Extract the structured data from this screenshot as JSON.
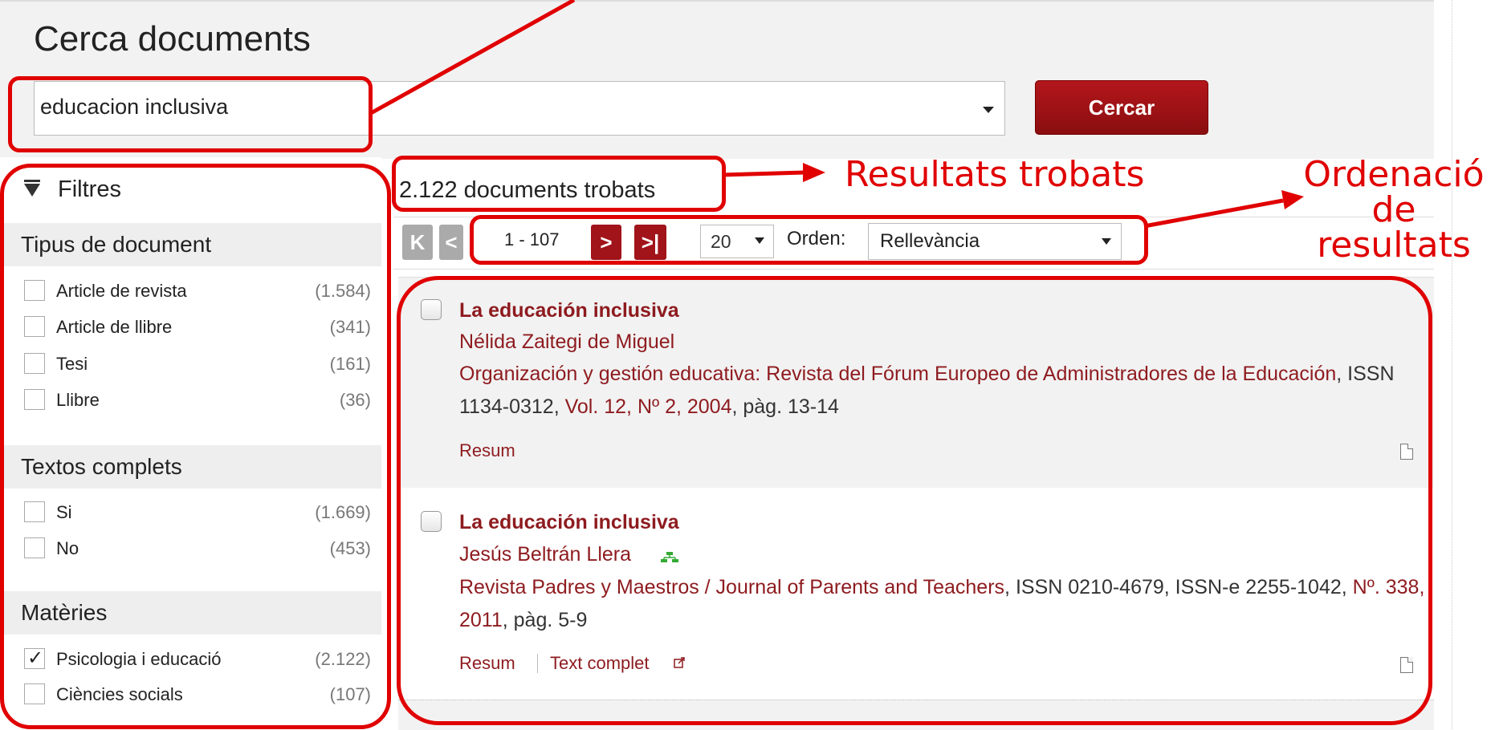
{
  "header": {
    "title": "Cerca documents",
    "search_value": "educacion inclusiva",
    "search_button": "Cercar"
  },
  "sidebar": {
    "filters_label": "Filtres",
    "sections": [
      {
        "title": "Tipus de document",
        "items": [
          {
            "label": "Article de revista",
            "count": "(1.584)",
            "checked": false
          },
          {
            "label": "Article de llibre",
            "count": "(341)",
            "checked": false
          },
          {
            "label": "Tesi",
            "count": "(161)",
            "checked": false
          },
          {
            "label": "Llibre",
            "count": "(36)",
            "checked": false
          }
        ]
      },
      {
        "title": "Textos complets",
        "items": [
          {
            "label": "Si",
            "count": "(1.669)",
            "checked": false
          },
          {
            "label": "No",
            "count": "(453)",
            "checked": false
          }
        ]
      },
      {
        "title": "Matèries",
        "items": [
          {
            "label": "Psicologia i educació",
            "count": "(2.122)",
            "checked": true
          },
          {
            "label": "Ciències socials",
            "count": "(107)",
            "checked": false
          }
        ]
      }
    ]
  },
  "results": {
    "count_text": "2.122 documents trobats",
    "pagination": {
      "first": "K",
      "prev": "<",
      "range": "1 - 107",
      "next": ">",
      "last": ">|",
      "per_page": "20",
      "order_label": "Orden:",
      "order_value": "Rellevància"
    },
    "items": [
      {
        "title": "La educación inclusiva",
        "author": "Nélida Zaitegi de Miguel",
        "source_a": "Organización y gestión educativa: Revista del Fórum Europeo de Administradores de la Educación",
        "source_b": ", ISSN 1134-0312, ",
        "source_c": "Vol. 12, Nº 2, 2004",
        "source_d": ", pàg. 13-14",
        "links": [
          "Resum"
        ]
      },
      {
        "title": "La educación inclusiva",
        "author": "Jesús Beltrán Llera",
        "source_a": "Revista Padres y Maestros / Journal of Parents and Teachers",
        "source_b": ", ISSN 0210-4679, ISSN-e 2255-1042, ",
        "source_c": "Nº. 338, 2011",
        "source_d": ", pàg. 5-9",
        "links": [
          "Resum",
          "Text complet"
        ]
      }
    ]
  },
  "annotations": {
    "found": "Resultats trobats",
    "order_l1": "Ordenació",
    "order_l2": "de",
    "order_l3": "resultats"
  },
  "colors": {
    "accent": "#a0141a",
    "annotation": "#e00000",
    "link": "#8e1b1f"
  }
}
